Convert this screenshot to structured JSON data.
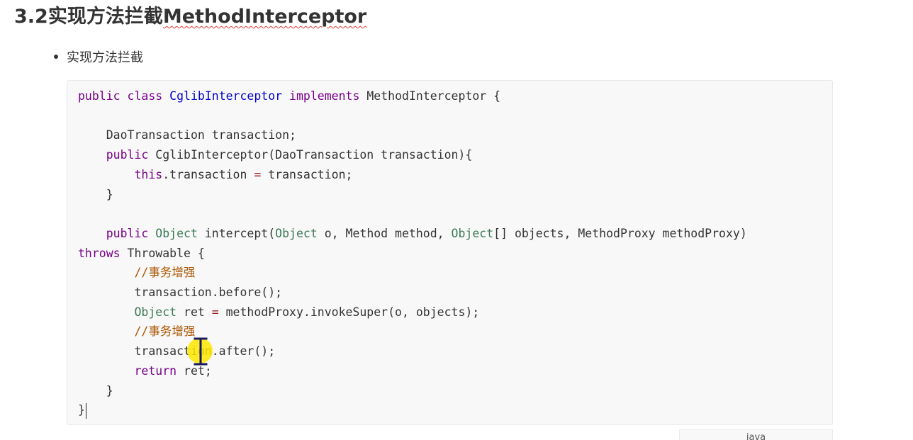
{
  "heading": {
    "number": "3.2",
    "cn": "实现方法拦截",
    "en": "MethodInterceptor"
  },
  "bullet": {
    "text": "实现方法拦截"
  },
  "code": {
    "lines": [
      "public class CglibInterceptor implements MethodInterceptor {",
      "",
      "    DaoTransaction transaction;",
      "    public CglibInterceptor(DaoTransaction transaction){",
      "        this.transaction = transaction;",
      "    }",
      "",
      "    public Object intercept(Object o, Method method, Object[] objects, MethodProxy methodProxy)",
      "throws Throwable {",
      "        //事务增强",
      "        transaction.before();",
      "        Object ret = methodProxy.invokeSuper(o, objects);",
      "        //事务增强",
      "        transaction.after();",
      "        return ret;",
      "    }",
      "}"
    ],
    "language": "java"
  },
  "colors": {
    "keyword": "#770088",
    "type": "#3b7a57",
    "definition": "#0000cc",
    "comment": "#aa5500",
    "operator": "#981a1a",
    "text": "#333333",
    "code_background": "#f8f8f8",
    "cursor_highlight": "#ffe600",
    "spellcheck_underline": "#e03b3b"
  },
  "icons": {
    "cursor": "ibeam-cursor-icon",
    "bullet": "bullet-dot-icon"
  }
}
